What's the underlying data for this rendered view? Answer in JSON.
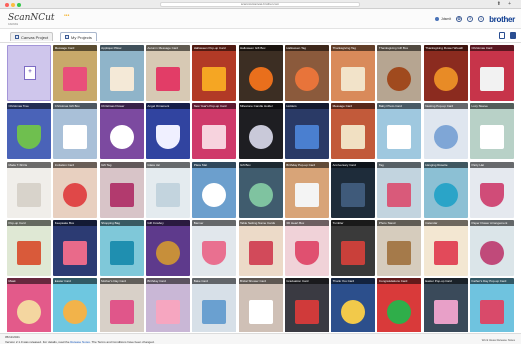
{
  "window": {
    "url": "scanncutcanvas.brother.com"
  },
  "header": {
    "logo": "ScanNCut",
    "logo_sub": "CANVAS",
    "user_label": "Jdsmit",
    "brand": "brother",
    "icons": [
      "user-icon",
      "settings-icon",
      "help-icon",
      "info-icon"
    ]
  },
  "tabs": [
    {
      "label": "Canvas Project",
      "active": false
    },
    {
      "label": "My Projects",
      "active": true
    }
  ],
  "new_project_label": "",
  "projects": [
    {
      "title": "Message Card",
      "bg": "#c8a96a",
      "fg": "#e94f7a",
      "shape": "sq"
    },
    {
      "title": "Appliqué Pillow",
      "bg": "#8fb4c9",
      "fg": "#f4e9d7",
      "shape": "sq"
    },
    {
      "title": "Autumn Message Card",
      "bg": "#d7c9b4",
      "fg": "#e23d67",
      "shape": "sq"
    },
    {
      "title": "Halloween Pop-up Card",
      "bg": "#b23a26",
      "fg": "#f5a623",
      "shape": "sq"
    },
    {
      "title": "Halloween Gift Box",
      "bg": "#3c2e23",
      "fg": "#e96f1c",
      "shape": "circle"
    },
    {
      "title": "Halloween Tag",
      "bg": "#8b5a3c",
      "fg": "#e8743a",
      "shape": "circle"
    },
    {
      "title": "Thanksgiving Tag",
      "bg": "#d98a5a",
      "fg": "#f2e3c9",
      "shape": "sq"
    },
    {
      "title": "Thanksgiving Gift Box",
      "bg": "#b6a591",
      "fg": "#a04a1e",
      "shape": "circle"
    },
    {
      "title": "Thanksgiving Flower Wreath",
      "bg": "#8b2b1f",
      "fg": "#e88b26",
      "shape": "circle"
    },
    {
      "title": "Christmas Card",
      "bg": "#c7344a",
      "fg": "#f2f2f2",
      "shape": "sq"
    },
    {
      "title": "Christmas Tree",
      "bg": "#4a63b8",
      "fg": "#6fbf4f",
      "shape": "tri"
    },
    {
      "title": "Christmas Gift Box",
      "bg": "#a9c0d8",
      "fg": "#ffffff",
      "shape": "sq"
    },
    {
      "title": "Christmas Flower",
      "bg": "#7c4aa0",
      "fg": "#ffffff",
      "shape": "circle"
    },
    {
      "title": "Angel Ornament",
      "bg": "#3144a0",
      "fg": "#f0f0ff",
      "shape": "tri"
    },
    {
      "title": "New Year's Pop-up Card",
      "bg": "#cf3a6a",
      "fg": "#f7d3de",
      "shape": "sq"
    },
    {
      "title": "Milestone Candle Holder",
      "bg": "#1e1e22",
      "fg": "#c9c9d9",
      "shape": "circle"
    },
    {
      "title": "Holders",
      "bg": "#2a3a66",
      "fg": "#4a7fd0",
      "shape": "sq"
    },
    {
      "title": "Message Card",
      "bg": "#c25a3a",
      "fg": "#f1e0c2",
      "shape": "sq"
    },
    {
      "title": "Baby Photo Card",
      "bg": "#9fc8df",
      "fg": "#ffffff",
      "shape": "sq"
    },
    {
      "title": "Nesting Pop-up Card",
      "bg": "#dfe6ef",
      "fg": "#7fa6d6",
      "shape": "circle"
    },
    {
      "title": "Lucy Sleeve",
      "bg": "#b8d1c7",
      "fg": "#ffffff",
      "shape": "sq"
    },
    {
      "title": "Made T-Shirts",
      "bg": "#f0eeea",
      "fg": "#d8d3cb",
      "shape": "sq"
    },
    {
      "title": "Invitation Card",
      "bg": "#e8d0c0",
      "fg": "#e04848",
      "shape": "circle"
    },
    {
      "title": "Gift Tag",
      "bg": "#d8c4c8",
      "fg": "#b23a6e",
      "shape": "sq"
    },
    {
      "title": "Glass Jar",
      "bg": "#e4ebef",
      "fg": "#c3d4de",
      "shape": "sq"
    },
    {
      "title": "Place Mat",
      "bg": "#6c9fcd",
      "fg": "#ffffff",
      "shape": "circle"
    },
    {
      "title": "Gift Box",
      "bg": "#405c6e",
      "fg": "#7fc3a0",
      "shape": "circle"
    },
    {
      "title": "Birthday Pop-up Card",
      "bg": "#d8a478",
      "fg": "#f4f4f4",
      "shape": "sq"
    },
    {
      "title": "Anniversary Card",
      "bg": "#1e2c3a",
      "fg": "#3f5a7a",
      "shape": "sq"
    },
    {
      "title": "Tag",
      "bg": "#c2d4df",
      "fg": "#d95a7a",
      "shape": "sq"
    },
    {
      "title": "Hanging Rosette",
      "bg": "#8cc0d4",
      "fg": "#2aa4c8",
      "shape": "circle"
    },
    {
      "title": "Party Hat",
      "bg": "#e5e9ef",
      "fg": "#d04c78",
      "shape": "tri"
    },
    {
      "title": "Pop-up Card",
      "bg": "#dfe8d4",
      "fg": "#d95a3a",
      "shape": "sq"
    },
    {
      "title": "Keepsake Box",
      "bg": "#2c3b73",
      "fg": "#e96a8a",
      "shape": "sq"
    },
    {
      "title": "Shopping Bag",
      "bg": "#7fc8d9",
      "fg": "#1f8fb0",
      "shape": "sq"
    },
    {
      "title": "Gift Cowboy",
      "bg": "#5e3a8c",
      "fg": "#c78f3a",
      "shape": "circle"
    },
    {
      "title": "Banner",
      "bg": "#e1e7ec",
      "fg": "#e97090",
      "shape": "tri"
    },
    {
      "title": "Table Setting Name Cards",
      "bg": "#ecdac8",
      "fg": "#d24a5a",
      "shape": "sq"
    },
    {
      "title": "3D Heart Box",
      "bg": "#f0d2d8",
      "fg": "#e05070",
      "shape": "tri"
    },
    {
      "title": "Tumbler",
      "bg": "#3a3a3a",
      "fg": "#c9403a",
      "shape": "sq"
    },
    {
      "title": "Photo Stand",
      "bg": "#d6ccbd",
      "fg": "#a57a4a",
      "shape": "sq"
    },
    {
      "title": "Calendar",
      "bg": "#f3e7d2",
      "fg": "#e24a5a",
      "shape": "sq"
    },
    {
      "title": "Paper Flower Arrangement",
      "bg": "#dbe5e9",
      "fg": "#c04a7a",
      "shape": "circle"
    },
    {
      "title": "Mask",
      "bg": "#e35a8a",
      "fg": "#f4d6a0",
      "shape": "circle"
    },
    {
      "title": "Easter Card",
      "bg": "#6ec7e0",
      "fg": "#f2b34a",
      "shape": "circle"
    },
    {
      "title": "Mother's Day Card",
      "bg": "#d8d0c8",
      "fg": "#e0568a",
      "shape": "sq"
    },
    {
      "title": "Birthday Card",
      "bg": "#c9b7d6",
      "fg": "#f6a6c0",
      "shape": "sq"
    },
    {
      "title": "Bake Card",
      "bg": "#d7e0e8",
      "fg": "#6aa0d0",
      "shape": "sq"
    },
    {
      "title": "Bridal Shower Card",
      "bg": "#cfc0b6",
      "fg": "#ffffff",
      "shape": "sq"
    },
    {
      "title": "Graduation Card",
      "bg": "#3a3a42",
      "fg": "#d03a3a",
      "shape": "sq"
    },
    {
      "title": "Thank You Card",
      "bg": "#2c4f8c",
      "fg": "#f2c94a",
      "shape": "circle"
    },
    {
      "title": "Congratulations Card",
      "bg": "#d93a3a",
      "fg": "#2fae4a",
      "shape": "circle"
    },
    {
      "title": "Easter Pop-up Card",
      "bg": "#3a4a5a",
      "fg": "#e8a0c8",
      "shape": "sq"
    },
    {
      "title": "Father's Day Pop-up Card",
      "bg": "#6fc3df",
      "fg": "#d94a6a",
      "shape": "sq"
    }
  ],
  "footer": {
    "version": "05/11/2021",
    "notice_prefix": "Version 2.1.0 was released. For details, read the",
    "notice_link": "Release Notes",
    "notice_suffix": "The Terms and Conditions have been changed.",
    "right_text": "Work Ideas  Release Notes"
  }
}
